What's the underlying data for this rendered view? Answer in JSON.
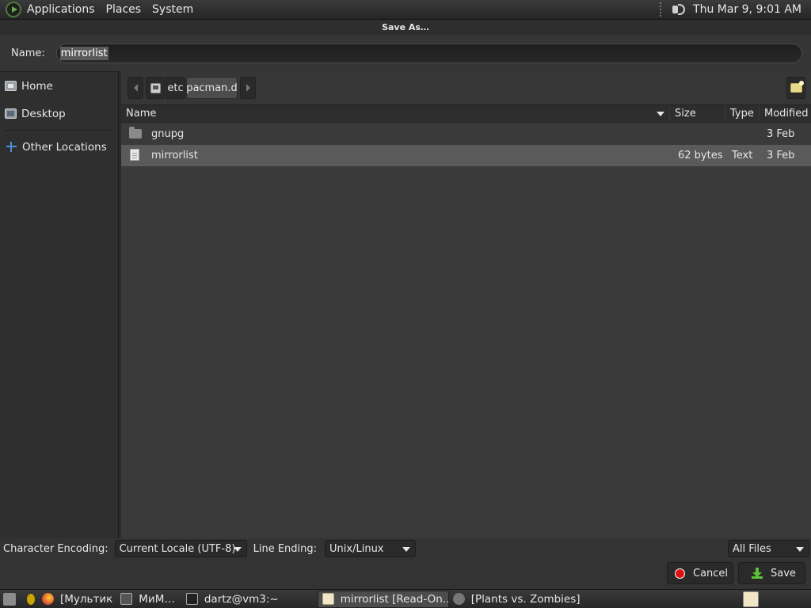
{
  "top_panel": {
    "menus": [
      "Applications",
      "Places",
      "System"
    ],
    "clock": "Thu Mar  9,  9:01 AM"
  },
  "dialog": {
    "title": "Save As…",
    "name_label": "Name:",
    "name_value": "mirrorlist",
    "sidebar": {
      "items": [
        {
          "label": "Home",
          "icon": "home-folder-icon"
        },
        {
          "label": "Desktop",
          "icon": "desktop-icon"
        },
        {
          "label": "Other Locations",
          "icon": "plus-icon"
        }
      ]
    },
    "pathbar": {
      "segments": [
        "etc",
        "pacman.d"
      ]
    },
    "columns": [
      "Name",
      "Size",
      "Type",
      "Modified"
    ],
    "files": [
      {
        "name": "gnupg",
        "size": "",
        "type": "",
        "modified": "3 Feb",
        "icon": "folder-icon"
      },
      {
        "name": "mirrorlist",
        "size": "62 bytes",
        "type": "Text",
        "modified": "3 Feb",
        "icon": "text-file-icon"
      }
    ],
    "options": {
      "encoding_label": "Character Encoding:",
      "encoding_value": "Current Locale (UTF-8)",
      "line_ending_label": "Line Ending:",
      "line_ending_value": "Unix/Linux",
      "filter_value": "All Files"
    },
    "buttons": {
      "cancel": "Cancel",
      "save": "Save"
    }
  },
  "taskbar": {
    "tasks": [
      {
        "label": "[Мультик"
      },
      {
        "label": "МиМ…"
      },
      {
        "label": "dartz@vm3:~"
      },
      {
        "label": "mirrorlist [Read-On…"
      },
      {
        "label": "[Plants vs. Zombies]"
      }
    ]
  }
}
